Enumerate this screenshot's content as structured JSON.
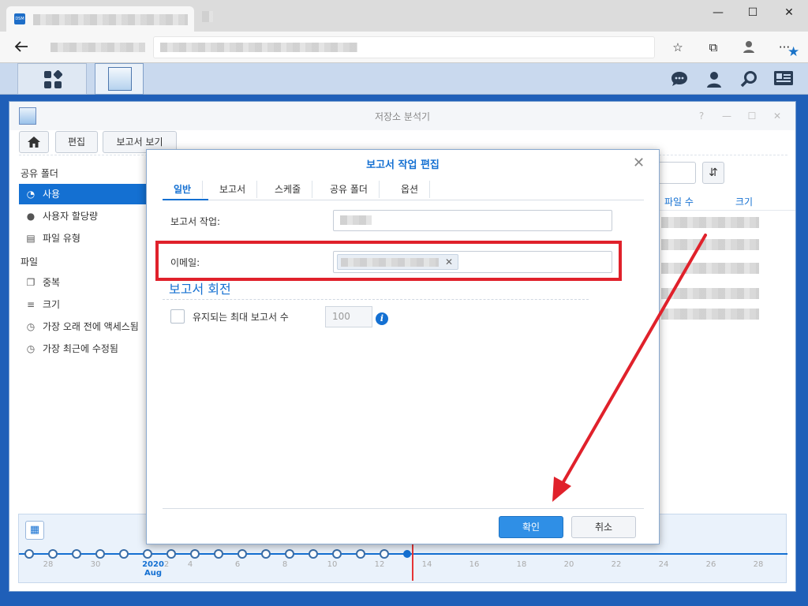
{
  "browser": {
    "tab_favicon_text": "DSM",
    "window_controls": [
      "—",
      "☐",
      "✕"
    ],
    "toolbar_icons": [
      "favorites-icon",
      "collections-icon",
      "profile-icon",
      "more-icon"
    ],
    "more_label": "···"
  },
  "colors": {
    "accent": "#1470d2",
    "annotation_red": "#e0212b",
    "ok_button": "#2f8fe6"
  },
  "window": {
    "title": "저장소 분석기",
    "controls": [
      "?",
      "—",
      "☐",
      "✕"
    ],
    "toolbar": {
      "edit_label": "편집",
      "view_report_label": "보고서 보기"
    },
    "sidebar": {
      "shared_folder_header": "공유 폴더",
      "shared_items": [
        {
          "label": "사용",
          "icon": "pie-chart-icon",
          "selected": true
        },
        {
          "label": "사용자 할당량",
          "icon": "user-icon"
        },
        {
          "label": "파일 유형",
          "icon": "file-icon"
        }
      ],
      "file_header": "파일",
      "file_items": [
        {
          "label": "중복",
          "icon": "duplicate-icon"
        },
        {
          "label": "크기",
          "icon": "size-bars-icon"
        },
        {
          "label": "가장 오래 전에 액세스됨",
          "icon": "clock-icon"
        },
        {
          "label": "가장 최근에 수정됨",
          "icon": "clock-icon"
        }
      ]
    },
    "table": {
      "columns": [
        "파일 수",
        "크기"
      ]
    }
  },
  "timeline": {
    "year": "2020",
    "month": "Aug",
    "labels": [
      "28",
      "30",
      "2",
      "4",
      "6",
      "8",
      "10",
      "12",
      "14",
      "16",
      "18",
      "20",
      "22",
      "24",
      "26",
      "28"
    ]
  },
  "dialog": {
    "title": "보고서 작업 편집",
    "tabs": [
      "일반",
      "보고서",
      "스케줄",
      "공유 폴더",
      "옵션"
    ],
    "active_tab": "일반",
    "report_task_label": "보고서 작업:",
    "email_label": "이메일:",
    "rotation_title": "보고서 회전",
    "max_reports_label": "유지되는 최대 보고서 수",
    "max_reports_value": "100",
    "max_reports_checked": false,
    "ok_label": "확인",
    "cancel_label": "취소"
  }
}
